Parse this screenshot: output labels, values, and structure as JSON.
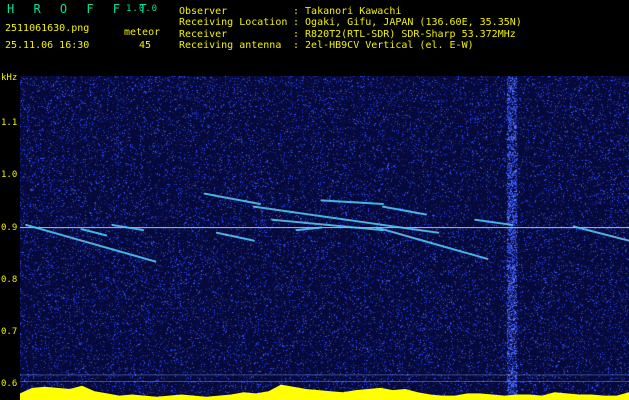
{
  "header": {
    "app_name": "H R O F F T",
    "app_version": "1.0.0",
    "filename": "2511061630.png",
    "timestamp": "25.11.06 16:30",
    "meteor_label": "meteor",
    "meteor_count": "45"
  },
  "info": [
    {
      "label": "Observer",
      "value": ": Takanori Kawachi"
    },
    {
      "label": "Receiving Location",
      "value": ": Ogaki, Gifu, JAPAN (136.60E, 35.35N)"
    },
    {
      "label": "Receiver",
      "value": ": R820T2(RTL-SDR) SDR-Sharp 53.372MHz"
    },
    {
      "label": "Receiving antenna",
      "value": ": 2el-HB9CV Vertical (el. E-W)"
    }
  ],
  "colors": {
    "text": "#f2f200",
    "title": "#00e2a0",
    "background": "#060a3a",
    "histogram": "#ffff00",
    "noise_dot": "#2a44ff",
    "echo": "#3fd4ff"
  },
  "chart_data": {
    "type": "heatmap",
    "y_unit": "kHz",
    "y_ticks": [
      1.1,
      1.0,
      0.9,
      0.8,
      0.7,
      0.6
    ],
    "y_tick_labels": [
      "1.1",
      "1.0",
      "0.9",
      "0.8",
      "0.7",
      "0.6"
    ],
    "x_ticks": [
      "1631",
      "1632",
      "1633",
      "1634",
      "1635",
      "1636",
      "1637",
      "1638",
      "1639",
      "1640"
    ],
    "x_range_minutes": [
      1630.4,
      1640.3
    ],
    "y_range_khz": [
      0.57,
      1.19
    ],
    "carrier_khz": 0.9,
    "interference_at_minute": 1638.4,
    "echoes": [
      {
        "t0": 1630.5,
        "f0": 0.905,
        "t1": 1632.6,
        "f1": 0.835
      },
      {
        "t0": 1631.4,
        "f0": 0.897,
        "t1": 1631.8,
        "f1": 0.885
      },
      {
        "t0": 1631.9,
        "f0": 0.905,
        "t1": 1632.4,
        "f1": 0.895
      },
      {
        "t0": 1633.4,
        "f0": 0.965,
        "t1": 1634.3,
        "f1": 0.945
      },
      {
        "t0": 1633.6,
        "f0": 0.89,
        "t1": 1634.2,
        "f1": 0.875
      },
      {
        "t0": 1634.2,
        "f0": 0.94,
        "t1": 1637.2,
        "f1": 0.89
      },
      {
        "t0": 1635.3,
        "f0": 0.952,
        "t1": 1636.3,
        "f1": 0.945
      },
      {
        "t0": 1636.3,
        "f0": 0.94,
        "t1": 1637.0,
        "f1": 0.925
      },
      {
        "t0": 1634.5,
        "f0": 0.915,
        "t1": 1636.3,
        "f1": 0.895
      },
      {
        "t0": 1636.2,
        "f0": 0.9,
        "t1": 1638.0,
        "f1": 0.84
      },
      {
        "t0": 1637.8,
        "f0": 0.915,
        "t1": 1638.4,
        "f1": 0.905
      },
      {
        "t0": 1634.9,
        "f0": 0.895,
        "t1": 1635.3,
        "f1": 0.9
      },
      {
        "t0": 1639.4,
        "f0": 0.902,
        "t1": 1640.3,
        "f1": 0.875
      }
    ],
    "activity_histogram": [
      0.3,
      0.55,
      0.6,
      0.55,
      0.5,
      0.65,
      0.4,
      0.3,
      0.2,
      0.25,
      0.2,
      0.15,
      0.2,
      0.25,
      0.2,
      0.15,
      0.2,
      0.25,
      0.35,
      0.3,
      0.4,
      0.7,
      0.6,
      0.5,
      0.45,
      0.4,
      0.35,
      0.45,
      0.5,
      0.55,
      0.45,
      0.5,
      0.35,
      0.25,
      0.2,
      0.2,
      0.3,
      0.3,
      0.25,
      0.2,
      0.25,
      0.25,
      0.2,
      0.35,
      0.3,
      0.25,
      0.25,
      0.2,
      0.2,
      0.35
    ]
  }
}
